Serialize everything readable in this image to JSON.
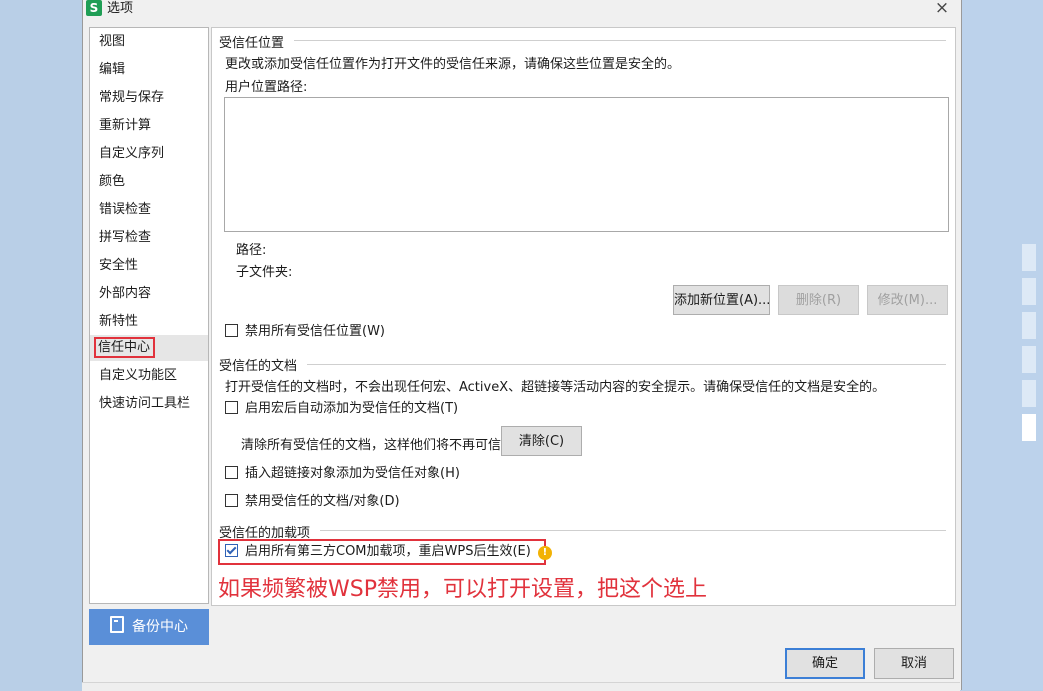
{
  "window": {
    "title": "选项",
    "app_logo_letter": "S",
    "close_glyph": "×"
  },
  "sidebar": {
    "items": [
      {
        "label": "视图"
      },
      {
        "label": "编辑"
      },
      {
        "label": "常规与保存"
      },
      {
        "label": "重新计算"
      },
      {
        "label": "自定义序列"
      },
      {
        "label": "颜色"
      },
      {
        "label": "错误检查"
      },
      {
        "label": "拼写检查"
      },
      {
        "label": "安全性"
      },
      {
        "label": "外部内容"
      },
      {
        "label": "新特性"
      },
      {
        "label": "信任中心",
        "selected": true
      },
      {
        "label": "自定义功能区"
      },
      {
        "label": "快速访问工具栏"
      }
    ],
    "backup_button": "备份中心",
    "backup_icon": "document-icon"
  },
  "trusted_locations": {
    "title": "受信任位置",
    "description": "更改或添加受信任位置作为打开文件的受信任来源，请确保这些位置是安全的。",
    "user_paths_label": "用户位置路径:",
    "path_label": "路径:",
    "subfolder_label": "子文件夹:",
    "add_button": "添加新位置(A)...",
    "delete_button": "删除(R)",
    "modify_button": "修改(M)...",
    "disable_all_checkbox": {
      "label": "禁用所有受信任位置(W)",
      "checked": false
    }
  },
  "trusted_documents": {
    "title": "受信任的文档",
    "description": "打开受信任的文档时，不会出现任何宏、ActiveX、超链接等活动内容的安全提示。请确保受信任的文档是安全的。",
    "auto_add_checkbox": {
      "label": "启用宏后自动添加为受信任的文档(T)",
      "checked": false
    },
    "clear_text": "清除所有受信任的文档，这样他们将不再可信",
    "clear_button": "清除(C)",
    "hyperlink_checkbox": {
      "label": "插入超链接对象添加为受信任对象(H)",
      "checked": false
    },
    "disable_docs_checkbox": {
      "label": "禁用受信任的文档/对象(D)",
      "checked": false
    }
  },
  "trusted_addins": {
    "title": "受信任的加载项",
    "com_checkbox": {
      "label": "启用所有第三方COM加载项，重启WPS后生效(E)",
      "checked": true
    },
    "warning_glyph": "!"
  },
  "annotation": "如果频繁被WSP禁用，可以打开设置，把这个选上",
  "footer": {
    "ok_button": "确定",
    "cancel_button": "取消"
  },
  "colors": {
    "accent_blue": "#5a8fd8",
    "annotation_red": "#e1323c",
    "warning_yellow": "#f2b205",
    "logo_green": "#1f9e55"
  }
}
